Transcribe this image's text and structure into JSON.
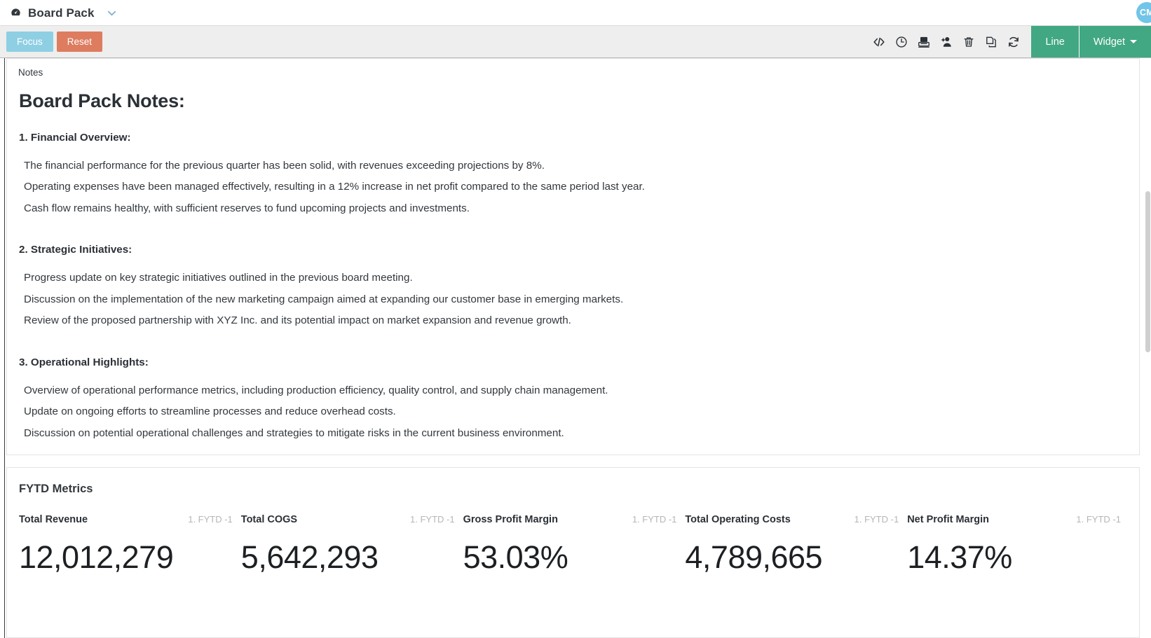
{
  "titlebar": {
    "icon": "gauge-icon",
    "title": "Board Pack",
    "dropdown_icon": "chevron-down-icon",
    "avatar_initials": "CM"
  },
  "toolbar": {
    "focus_label": "Focus",
    "reset_label": "Reset",
    "focus_color": "#8ecfe3",
    "reset_color": "#de7c5f",
    "green_color": "#41a883",
    "icons": [
      {
        "name": "code-icon",
        "title": "</>"
      },
      {
        "name": "clock-icon",
        "title": "Clock"
      },
      {
        "name": "save-icon",
        "title": "Save"
      },
      {
        "name": "user-edit-icon",
        "title": "User"
      },
      {
        "name": "trash-icon",
        "title": "Delete"
      },
      {
        "name": "copy-icon",
        "title": "Copy"
      },
      {
        "name": "refresh-icon",
        "title": "Refresh"
      }
    ],
    "line_label": "Line",
    "widget_label": "Widget"
  },
  "notes": {
    "card_label": "Notes",
    "heading": "Board Pack Notes:",
    "sections": [
      {
        "heading": "1. Financial Overview:",
        "lines": [
          "The financial performance for the previous quarter has been solid, with revenues exceeding projections by 8%.",
          "Operating expenses have been managed effectively, resulting in a 12% increase in net profit compared to the same period last year.",
          "Cash flow remains healthy, with sufficient reserves to fund upcoming projects and investments."
        ]
      },
      {
        "heading": "2. Strategic Initiatives:",
        "lines": [
          "Progress update on key strategic initiatives outlined in the previous board meeting.",
          "Discussion on the implementation of the new marketing campaign aimed at expanding our customer base in emerging markets.",
          "Review of the proposed partnership with XYZ Inc. and its potential impact on market expansion and revenue growth."
        ]
      },
      {
        "heading": "3. Operational Highlights:",
        "lines": [
          "Overview of operational performance metrics, including production efficiency, quality control, and supply chain management.",
          "Update on ongoing efforts to streamline processes and reduce overhead costs.",
          "Discussion on potential operational challenges and strategies to mitigate risks in the current business environment."
        ]
      }
    ]
  },
  "metrics": {
    "title": "FYTD Metrics",
    "items": [
      {
        "name": "Total Revenue",
        "period": "1. FYTD -1",
        "value": "12,012,279"
      },
      {
        "name": "Total COGS",
        "period": "1. FYTD -1",
        "value": "5,642,293"
      },
      {
        "name": "Gross Profit Margin",
        "period": "1. FYTD -1",
        "value": "53.03%"
      },
      {
        "name": "Total Operating Costs",
        "period": "1. FYTD -1",
        "value": "4,789,665"
      },
      {
        "name": "Net Profit Margin",
        "period": "1. FYTD -1",
        "value": "14.37%"
      }
    ]
  }
}
